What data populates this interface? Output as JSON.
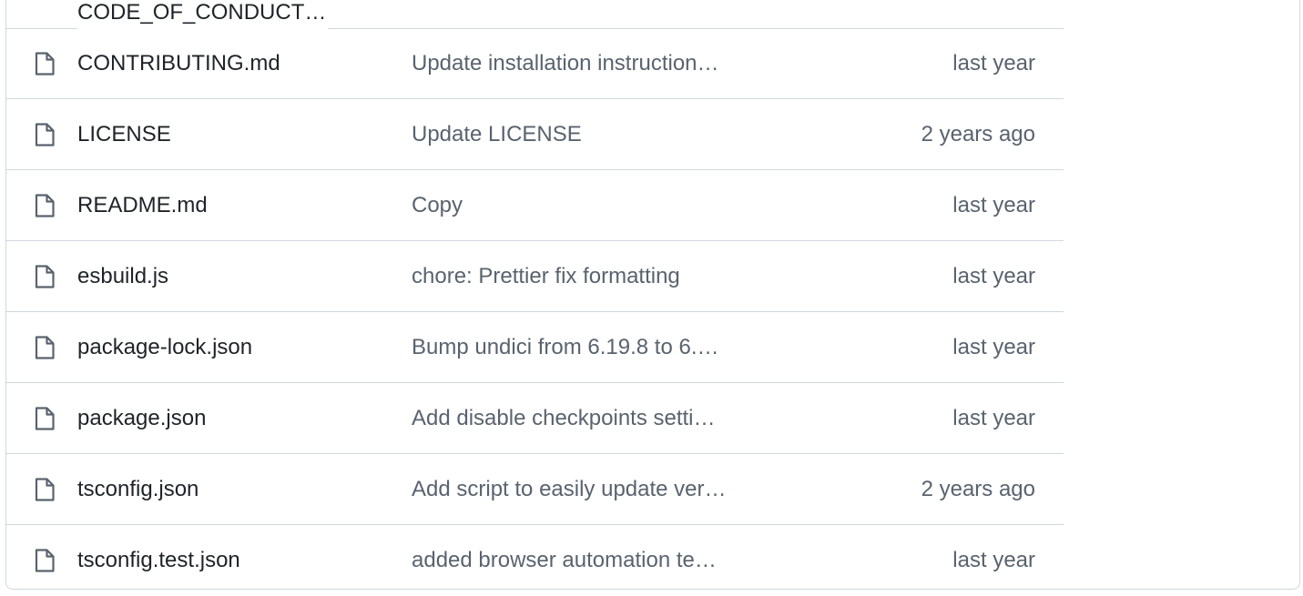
{
  "partial_row": {
    "name": "CODE_OF_CONDUCT…"
  },
  "rows": [
    {
      "name": "CONTRIBUTING.md",
      "message": "Update installation instruction…",
      "time": "last year"
    },
    {
      "name": "LICENSE",
      "message": "Update LICENSE",
      "time": "2 years ago"
    },
    {
      "name": "README.md",
      "message": "Copy",
      "time": "last year"
    },
    {
      "name": "esbuild.js",
      "message": "chore: Prettier fix formatting",
      "time": "last year"
    },
    {
      "name": "package-lock.json",
      "message": "Bump undici from 6.19.8 to 6.…",
      "time": "last year"
    },
    {
      "name": "package.json",
      "message": "Add disable checkpoints setti…",
      "time": "last year"
    },
    {
      "name": "tsconfig.json",
      "message": "Add script to easily update ver…",
      "time": "2 years ago"
    },
    {
      "name": "tsconfig.test.json",
      "message": "added browser automation te…",
      "time": "last year"
    }
  ],
  "icon": "file-icon",
  "colors": {
    "text": "#1f2328",
    "muted": "#59636e",
    "border": "#d0d7de"
  }
}
